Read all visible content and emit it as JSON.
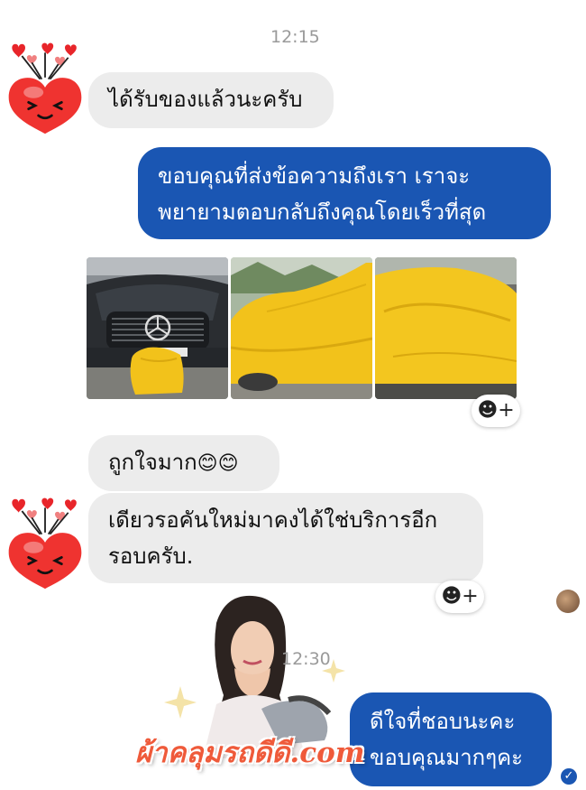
{
  "conversation": {
    "timestamp_1": "12:15",
    "timestamp_2": "12:30",
    "messages": {
      "m1": "ได้รับของแล้วนะครับ",
      "m2_line1": "ขอบคุณที่ส่งข้อความถึงเรา เราจะ",
      "m2_line2": "พยายามตอบกลับถึงคุณโดยเร็วที่สุด",
      "m3": "ถูกใจมาก",
      "m3_emoji": "😊😊",
      "m4_line1": "เดียวรอคันใหม่มาคงได้ใช่บริการอีก",
      "m4_line2": "รอบครับ.",
      "m5_line1": "ดีใจที่ชอบนะคะ",
      "m5_line2": "ขอบคุณมากๆคะ"
    },
    "react_label": "☻+",
    "seen_mark": "✓"
  },
  "watermark": {
    "text": "ผ้าคลุมรถดีดี.com"
  },
  "icons": {
    "avatar": "heart-avatar-icon",
    "add_reaction": "smiley-plus-icon",
    "seen": "check-icon"
  },
  "colors": {
    "outgoing_bubble": "#1a56b3",
    "incoming_bubble": "#ececec",
    "car_cover_yellow": "#f2c21b",
    "watermark": "#ef5a3a"
  }
}
